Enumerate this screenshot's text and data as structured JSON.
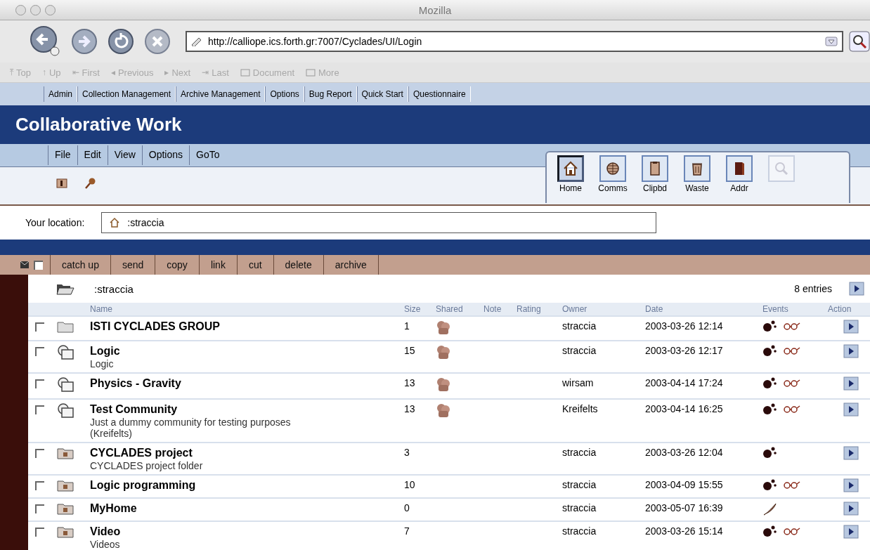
{
  "window": {
    "title": "Mozilla"
  },
  "navigation": {
    "url": "http://calliope.ics.forth.gr:7007/Cyclades/UI/Login"
  },
  "personal_toolbar": [
    {
      "kind": "glyph",
      "glyph": "⤒",
      "label": "Top",
      "disabled": true
    },
    {
      "kind": "glyph",
      "glyph": "↑",
      "label": "Up",
      "disabled": true
    },
    {
      "kind": "glyph",
      "glyph": "⇤",
      "label": "First",
      "disabled": true
    },
    {
      "kind": "glyph",
      "glyph": "◂",
      "label": "Previous",
      "disabled": true
    },
    {
      "kind": "glyph",
      "glyph": "▸",
      "label": "Next",
      "disabled": true
    },
    {
      "kind": "glyph",
      "glyph": "⇥",
      "label": "Last",
      "disabled": true
    },
    {
      "kind": "folder",
      "label": "Document",
      "disabled": true
    },
    {
      "kind": "folder",
      "label": "More",
      "disabled": true
    }
  ],
  "app_menu": [
    "Admin",
    "Collection Management",
    "Archive Management",
    "Options",
    "Bug Report",
    "Quick Start",
    "Questionnaire"
  ],
  "header": {
    "title": "Collaborative Work"
  },
  "menu": [
    "File",
    "Edit",
    "View",
    "Options",
    "GoTo"
  ],
  "toolbox": [
    {
      "kind": "home",
      "label": "Home",
      "selected": true,
      "disabled": false
    },
    {
      "kind": "globe",
      "label": "Comms",
      "selected": false,
      "disabled": false
    },
    {
      "kind": "clipboard",
      "label": "Clipbd",
      "selected": false,
      "disabled": false
    },
    {
      "kind": "trash",
      "label": "Waste",
      "selected": false,
      "disabled": false
    },
    {
      "kind": "book",
      "label": "Addr",
      "selected": false,
      "disabled": false
    },
    {
      "kind": "search",
      "selected": false,
      "disabled": true
    }
  ],
  "location": {
    "label": "Your location:",
    "value": ":straccia"
  },
  "actions": {
    "select_all_checked": false,
    "buttons": [
      "catch up",
      "send",
      "copy",
      "link",
      "cut",
      "delete",
      "archive"
    ]
  },
  "listing": {
    "folder": ":straccia",
    "entries": "8 entries",
    "columns": [
      "Name",
      "Size",
      "Shared",
      "Note",
      "Rating",
      "Owner",
      "Date",
      "Events",
      "Action"
    ],
    "rows": [
      {
        "kind": "folder",
        "checked": false,
        "name": "ISTI CYCLADES GROUP",
        "size": "1",
        "shared": true,
        "owner": "straccia",
        "date": "2003-03-26 12:14",
        "events": [
          {
            "kind": "activity"
          },
          {
            "kind": "glasses"
          }
        ]
      },
      {
        "kind": "community",
        "checked": false,
        "name": "Logic",
        "description": "Logic",
        "size": "15",
        "shared": true,
        "owner": "straccia",
        "date": "2003-03-26 12:17",
        "events": [
          {
            "kind": "activity"
          },
          {
            "kind": "glasses"
          }
        ]
      },
      {
        "kind": "community",
        "checked": false,
        "name": "Physics - Gravity",
        "size": "13",
        "shared": true,
        "owner": "wirsam",
        "date": "2003-04-14 17:24",
        "events": [
          {
            "kind": "activity"
          },
          {
            "kind": "glasses"
          }
        ]
      },
      {
        "kind": "community",
        "checked": false,
        "name": "Test Community",
        "description": "Just a dummy community for testing purposes (Kreifelts)",
        "size": "13",
        "shared": true,
        "owner": "Kreifelts",
        "date": "2003-04-14 16:25",
        "events": [
          {
            "kind": "activity"
          },
          {
            "kind": "glasses"
          }
        ]
      },
      {
        "kind": "project",
        "checked": false,
        "name": "CYCLADES project",
        "description": "CYCLADES project folder",
        "size": "3",
        "shared": false,
        "owner": "straccia",
        "date": "2003-03-26 12:04",
        "events": [
          {
            "kind": "activity"
          }
        ]
      },
      {
        "kind": "project",
        "checked": false,
        "name": "Logic programming",
        "size": "10",
        "shared": false,
        "owner": "straccia",
        "date": "2003-04-09 15:55",
        "events": [
          {
            "kind": "activity"
          },
          {
            "kind": "glasses"
          }
        ]
      },
      {
        "kind": "project",
        "checked": false,
        "name": "MyHome",
        "size": "0",
        "shared": false,
        "owner": "straccia",
        "date": "2003-05-07 16:39",
        "events": [
          {
            "kind": "pen"
          }
        ]
      },
      {
        "kind": "project",
        "checked": false,
        "name": "Video",
        "description": "Videos",
        "size": "7",
        "shared": false,
        "owner": "straccia",
        "date": "2003-03-26 15:14",
        "events": [
          {
            "kind": "activity"
          },
          {
            "kind": "glasses"
          }
        ]
      }
    ]
  }
}
